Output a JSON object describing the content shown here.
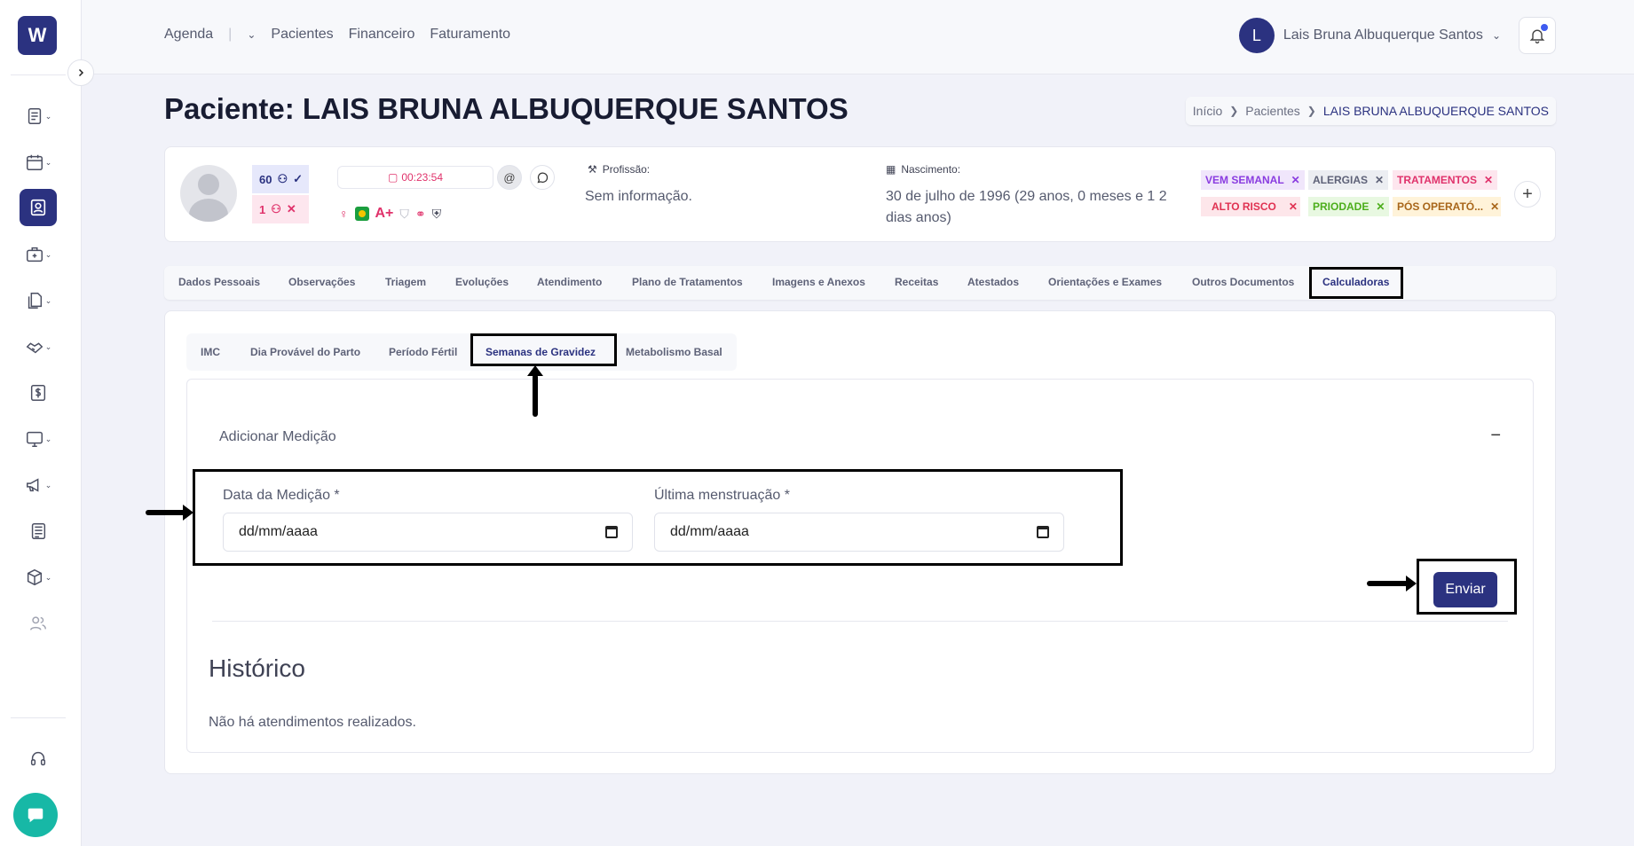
{
  "logo": {
    "letter": "W"
  },
  "topnav": {
    "menu": [
      "Agenda",
      "Pacientes",
      "Financeiro",
      "Faturamento"
    ],
    "user": {
      "initial": "L",
      "name": "Lais Bruna Albuquerque Santos"
    }
  },
  "page": {
    "title": "Paciente: LAIS BRUNA ALBUQUERQUE SANTOS"
  },
  "breadcrumb": [
    "Início",
    "Pacientes",
    "LAIS BRUNA ALBUQUERQUE SANTOS"
  ],
  "patient": {
    "count_ok": "60",
    "count_bad": "1",
    "timer": "00:23:54",
    "blood_type": "A+",
    "profession_label": "Profissão:",
    "profession_value": "Sem informação.",
    "birth_label": "Nascimento:",
    "birth_value": "30 de julho de 1996 (29 anos, 0 meses e 1 2 dias anos)",
    "tags": [
      {
        "label": "VEM SEMANAL",
        "bg": "#f0e6fb",
        "color": "#8a3ce0"
      },
      {
        "label": "ALERGIAS",
        "bg": "#eceef2",
        "color": "#5e6278"
      },
      {
        "label": "TRATAMENTOS",
        "bg": "#fde6ee",
        "color": "#e0326b"
      },
      {
        "label": "ALTO RISCO",
        "bg": "#fde6ea",
        "color": "#e03252"
      },
      {
        "label": "PRIODADE",
        "bg": "#e8f8e1",
        "color": "#4cae1c"
      },
      {
        "label": "PÓS OPERATÓ...",
        "bg": "#fff3d9",
        "color": "#a8661a"
      }
    ]
  },
  "main_tabs": [
    "Dados Pessoais",
    "Observações",
    "Triagem",
    "Evoluções",
    "Atendimento",
    "Plano de Tratamentos",
    "Imagens e Anexos",
    "Receitas",
    "Atestados",
    "Orientações e Exames",
    "Outros Documentos",
    "Calculadoras"
  ],
  "sub_tabs": [
    "IMC",
    "Dia Provável do Parto",
    "Período Fértil",
    "Semanas de Gravidez",
    "Metabolismo Basal"
  ],
  "form": {
    "section_title": "Adicionar Medição",
    "collapse_symbol": "−",
    "date_label": "Data da Medição *",
    "date_value": "dd/mm/aaaa",
    "last_label": "Última menstruação *",
    "last_value": "dd/mm/aaaa",
    "submit": "Enviar"
  },
  "history": {
    "title": "Histórico",
    "empty": "Não há atendimentos realizados."
  }
}
